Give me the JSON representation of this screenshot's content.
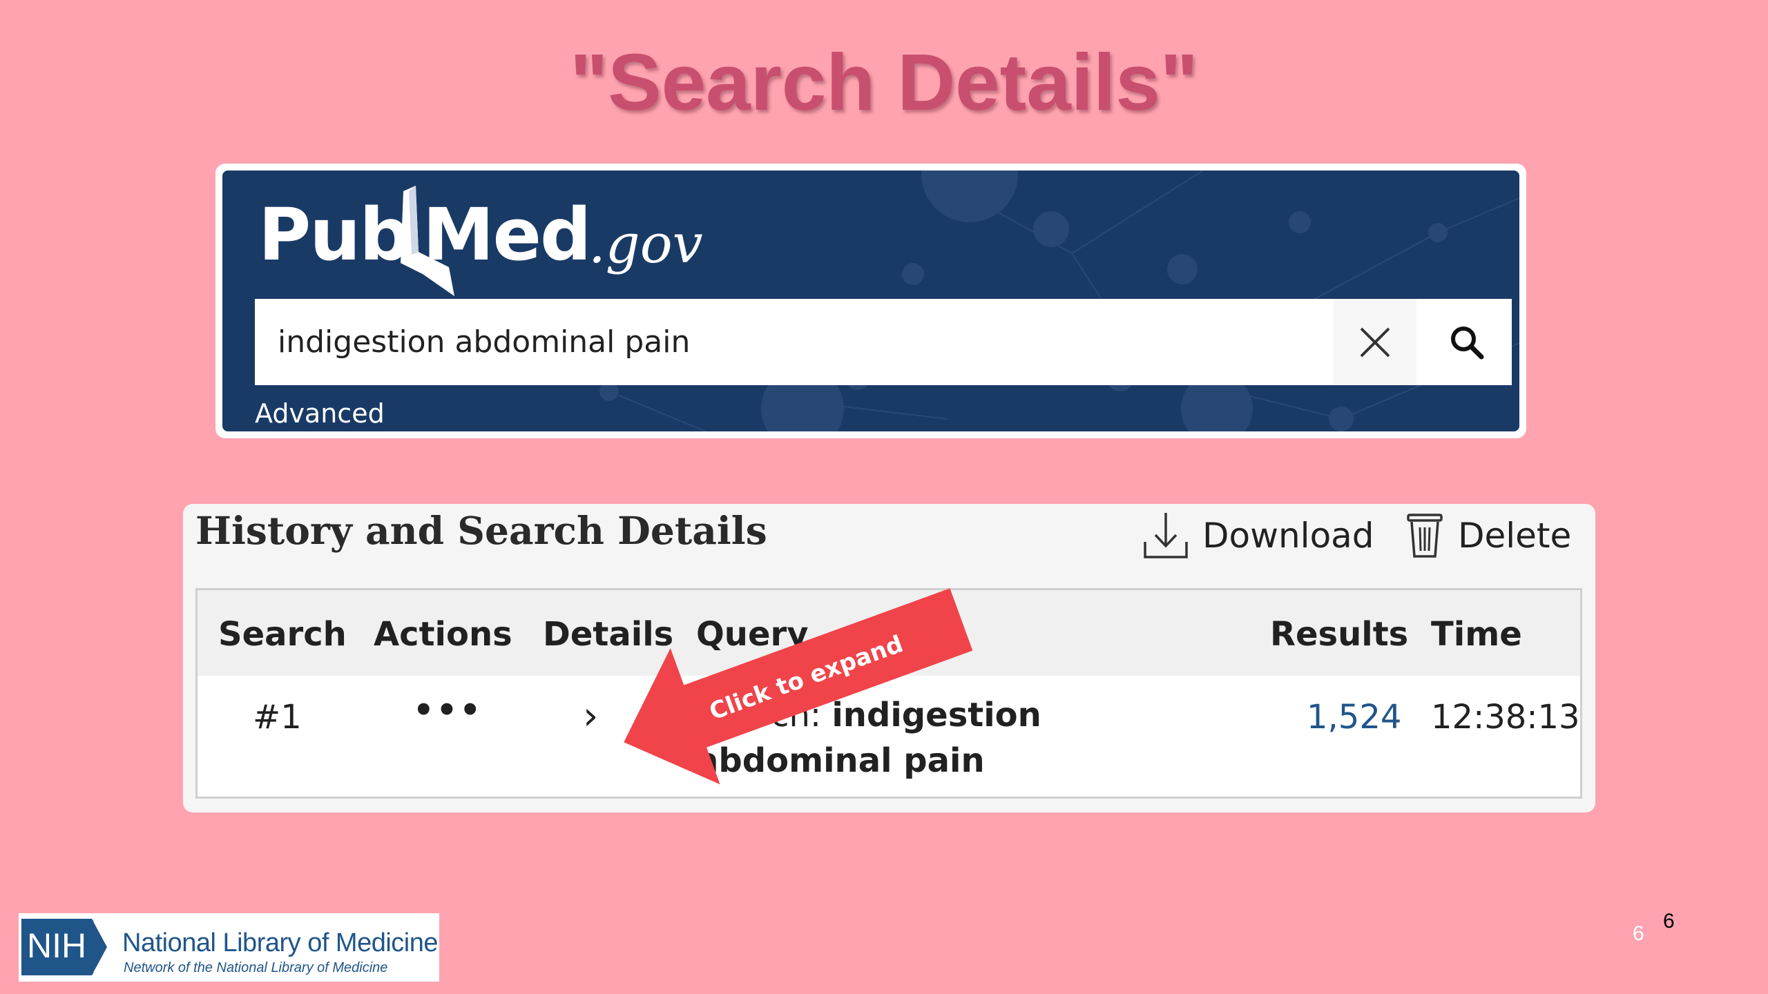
{
  "slide": {
    "title": "\"Search Details\"",
    "page_number_light": "6",
    "page_number": "6"
  },
  "pubmed": {
    "logo": {
      "pub": "Pub",
      "med": "Med",
      "gov": ".gov"
    },
    "search": {
      "value": "indigestion abdominal pain"
    },
    "advanced_label": "Advanced",
    "icons": {
      "clear": "close-icon",
      "search": "search-icon"
    }
  },
  "history": {
    "title": "History and Search Details",
    "download_label": "Download",
    "delete_label": "Delete",
    "columns": [
      "Search",
      "Actions",
      "Details",
      "Query",
      "Results",
      "Time"
    ],
    "rows": [
      {
        "search": "#1",
        "actions": "•••",
        "details": "›",
        "query_prefix": "Search: ",
        "query_bold_1": "indigestion",
        "query_bold_2": "abdominal pain",
        "results": "1,524",
        "time": "12:38:13"
      }
    ]
  },
  "annotation": {
    "arrow_label": "Click to expand",
    "color": "#f0444a"
  },
  "footer": {
    "nih_abbr": "NIH",
    "org_name": "National Library of Medicine",
    "org_sub": "Network of the National Library of Medicine"
  }
}
